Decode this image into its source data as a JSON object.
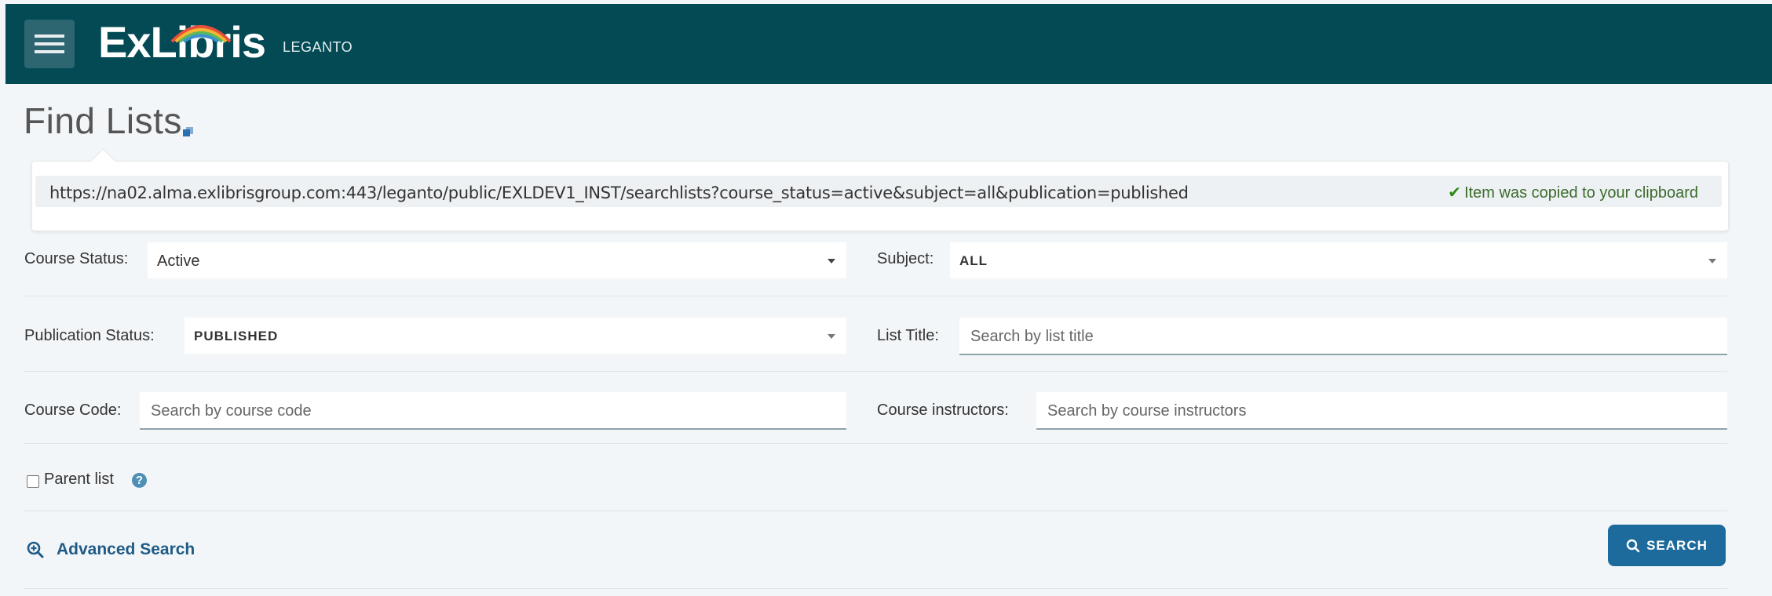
{
  "header": {
    "brand_name": "ExLibris",
    "product_name": "LEGANTO",
    "menu_icon": "hamburger-menu-icon",
    "brand_color": "#034a55"
  },
  "page": {
    "title": "Find Lists",
    "copy_link_icon": "copy-link-icon"
  },
  "url_popover": {
    "url": "https://na02.alma.exlibrisgroup.com:443/leganto/public/EXLDEV1_INST/searchlists?course_status=active&subject=all&publication=published",
    "copied_message": "Item was copied to your clipboard",
    "check_icon": "check-icon"
  },
  "form": {
    "course_status": {
      "label": "Course Status:",
      "value": "Active"
    },
    "subject": {
      "label": "Subject:",
      "value": "ALL"
    },
    "publication_status": {
      "label": "Publication Status:",
      "value": "PUBLISHED"
    },
    "list_title": {
      "label": "List Title:",
      "placeholder": "Search by list title"
    },
    "course_code": {
      "label": "Course Code:",
      "placeholder": "Search by course code"
    },
    "course_instructors": {
      "label": "Course instructors:",
      "placeholder": "Search by course instructors"
    },
    "parent_list": {
      "label": "Parent list",
      "checked": false,
      "help_icon": "question-circle-icon"
    }
  },
  "actions": {
    "advanced_search": "Advanced Search",
    "advanced_search_icon": "zoom-plus-icon",
    "search_button": "SEARCH",
    "search_icon": "search-icon",
    "accent_color": "#1d6a9c"
  }
}
